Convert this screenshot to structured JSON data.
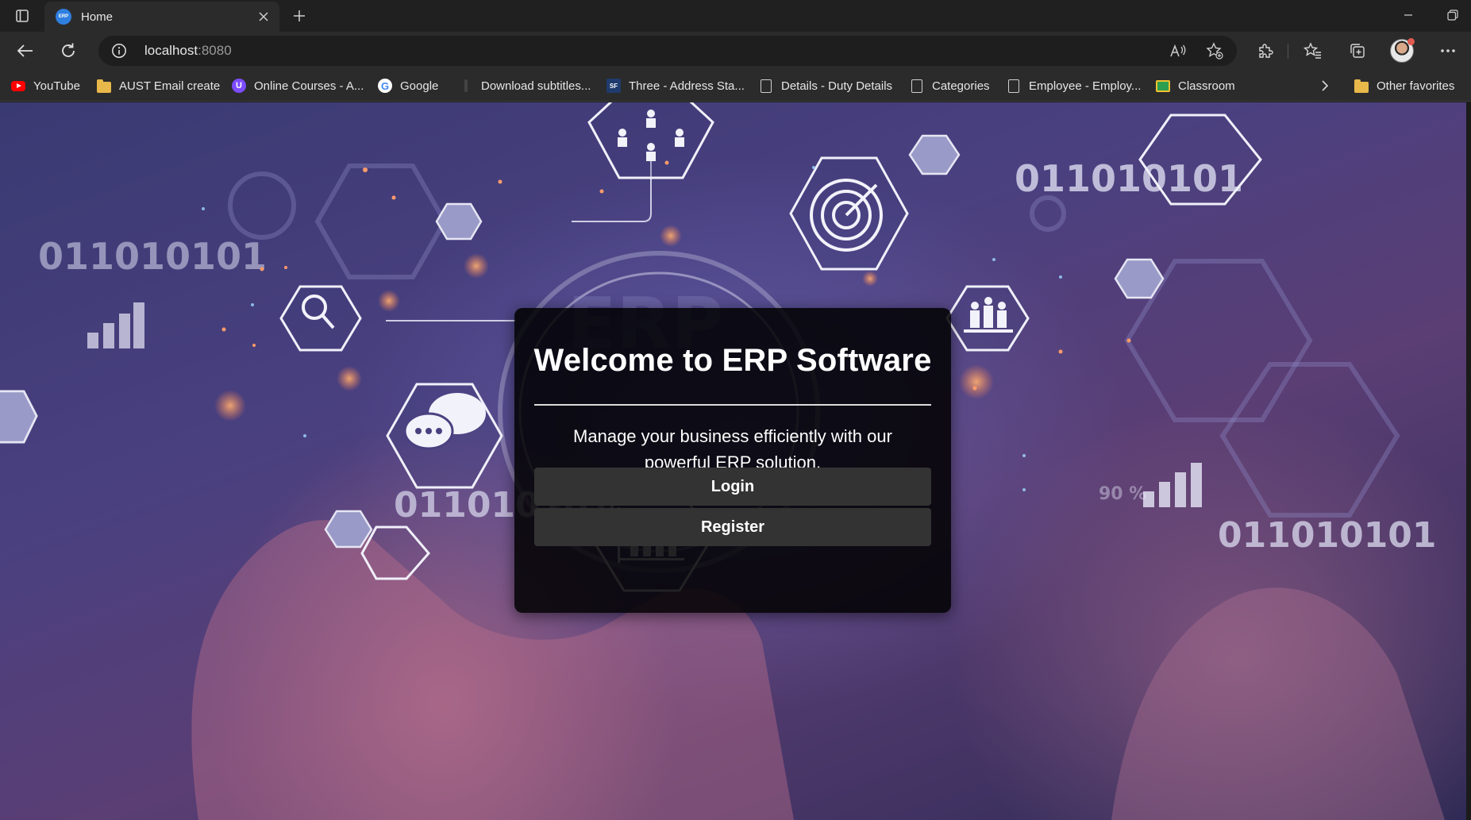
{
  "browser": {
    "tab_title": "Home",
    "tab_favicon_text": "ERP",
    "url_host": "localhost",
    "url_port": ":8080"
  },
  "favorites": [
    {
      "label": "YouTube",
      "icon": "youtube-icon"
    },
    {
      "label": "AUST Email create",
      "icon": "folder-icon"
    },
    {
      "label": "Online Courses - A...",
      "icon": "course-site-icon"
    },
    {
      "label": "Google",
      "icon": "google-icon"
    },
    {
      "label": "Download subtitles...",
      "icon": "site-icon"
    },
    {
      "label": "Three - Address Sta...",
      "icon": "site-icon"
    },
    {
      "label": "Details - Duty Details",
      "icon": "page-icon"
    },
    {
      "label": "Categories",
      "icon": "page-icon"
    },
    {
      "label": "Employee - Employ...",
      "icon": "page-icon"
    },
    {
      "label": "Classroom",
      "icon": "classroom-icon"
    }
  ],
  "other_favorites": "Other favorites",
  "background": {
    "binary_text": "011010101",
    "watermark": "ERP",
    "percent": "90 %"
  },
  "card": {
    "title": "Welcome to ERP Software",
    "description": "Manage your business efficiently with our powerful ERP solution.",
    "login_label": "Login",
    "register_label": "Register"
  },
  "colors": {
    "card_bg": "#000000",
    "button_bg": "#333333",
    "text": "#ffffff"
  }
}
